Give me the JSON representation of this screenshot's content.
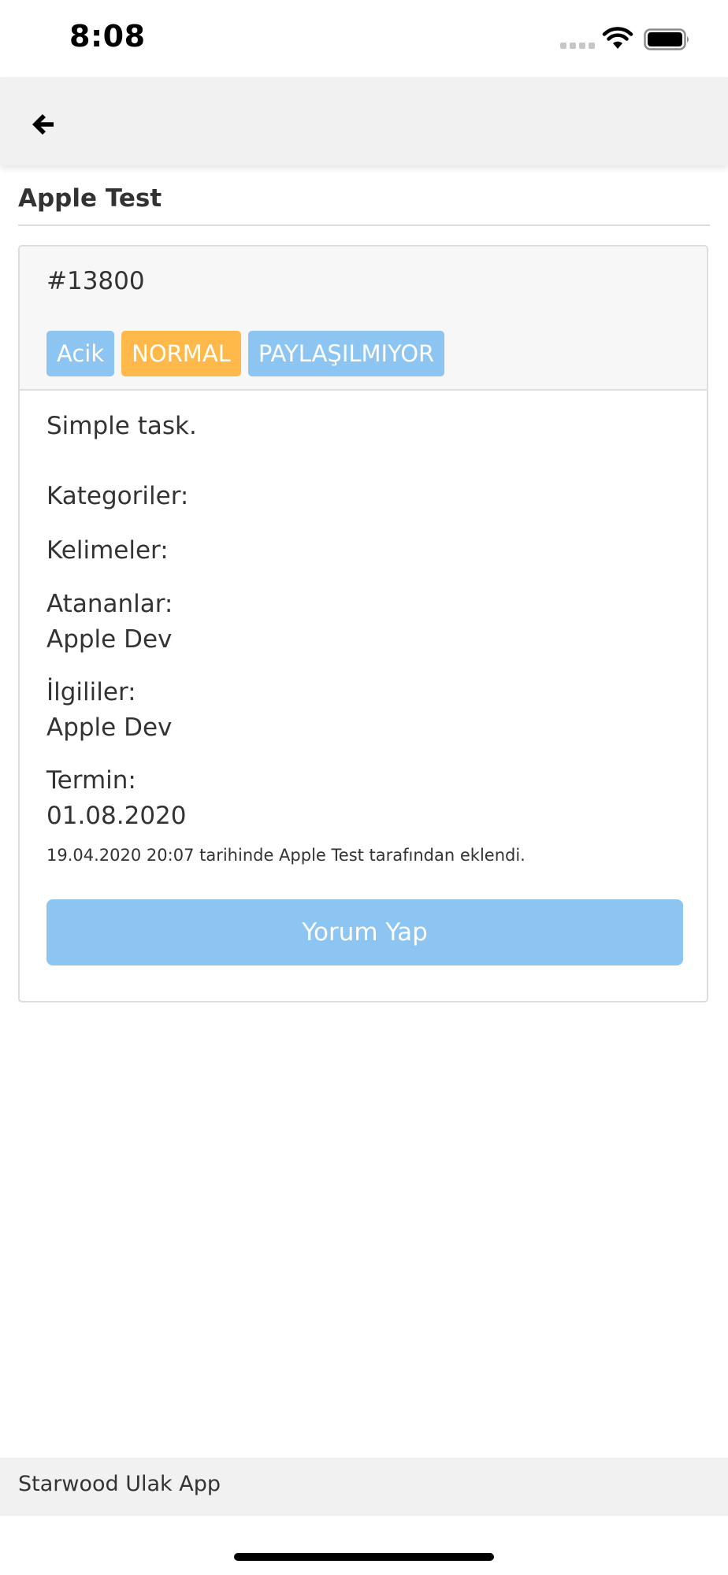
{
  "status_bar": {
    "time": "8:08",
    "icons": [
      "signal-dots-icon",
      "wifi-icon",
      "battery-icon"
    ]
  },
  "nav": {
    "back_icon": "arrow-left-icon"
  },
  "page": {
    "title": "Apple Test"
  },
  "task": {
    "id": "#13800",
    "badges": [
      {
        "label": "Acik",
        "color": "#8cc4f2"
      },
      {
        "label": "NORMAL",
        "color": "#ffb84a"
      },
      {
        "label": "PAYLAŞILMIYOR",
        "color": "#8cc4f2"
      }
    ],
    "description": "Simple task.",
    "categories_label": "Kategoriler:",
    "keywords_label": "Kelimeler:",
    "assignees_label": "Atananlar:",
    "assignees_value": "Apple Dev",
    "related_label": "İlgililer:",
    "related_value": "Apple Dev",
    "deadline_label": "Termin:",
    "deadline_value": "01.08.2020",
    "added_info": "19.04.2020 20:07 tarihinde Apple Test tarafından eklendi.",
    "comment_button": "Yorum Yap"
  },
  "footer": {
    "app_name": "Starwood Ulak App"
  },
  "colors": {
    "accent_blue": "#8cc4f2",
    "accent_orange": "#ffb84a",
    "nav_background": "#f1f1f1"
  }
}
